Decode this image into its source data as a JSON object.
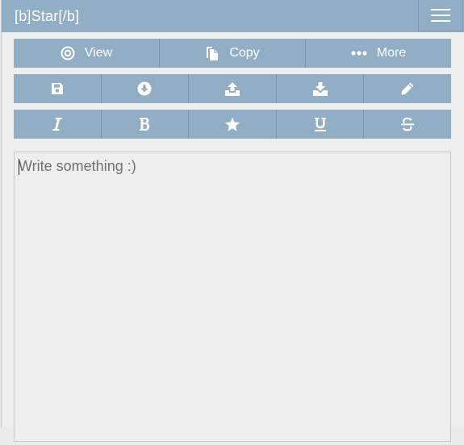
{
  "header": {
    "title": "[b]Star[/b]",
    "menu_icon": "hamburger-icon"
  },
  "toolbar_top": [
    {
      "label": "View",
      "icon": "eye-target-icon"
    },
    {
      "label": "Copy",
      "icon": "copy-icon"
    },
    {
      "label": "More",
      "icon": "ellipsis-icon"
    }
  ],
  "toolbar_file": [
    {
      "icon": "save-icon"
    },
    {
      "icon": "download-circle-icon"
    },
    {
      "icon": "upload-icon"
    },
    {
      "icon": "download-tray-icon"
    },
    {
      "icon": "pencil-icon"
    }
  ],
  "toolbar_format": [
    {
      "icon": "italic-icon"
    },
    {
      "icon": "bold-icon"
    },
    {
      "icon": "star-icon"
    },
    {
      "icon": "underline-icon"
    },
    {
      "icon": "strikethrough-icon"
    }
  ],
  "editor": {
    "placeholder": "Write something :)",
    "value": ""
  },
  "colors": {
    "accent": "#91aec4",
    "background": "#eeeeee",
    "button_text": "#ffffff"
  }
}
